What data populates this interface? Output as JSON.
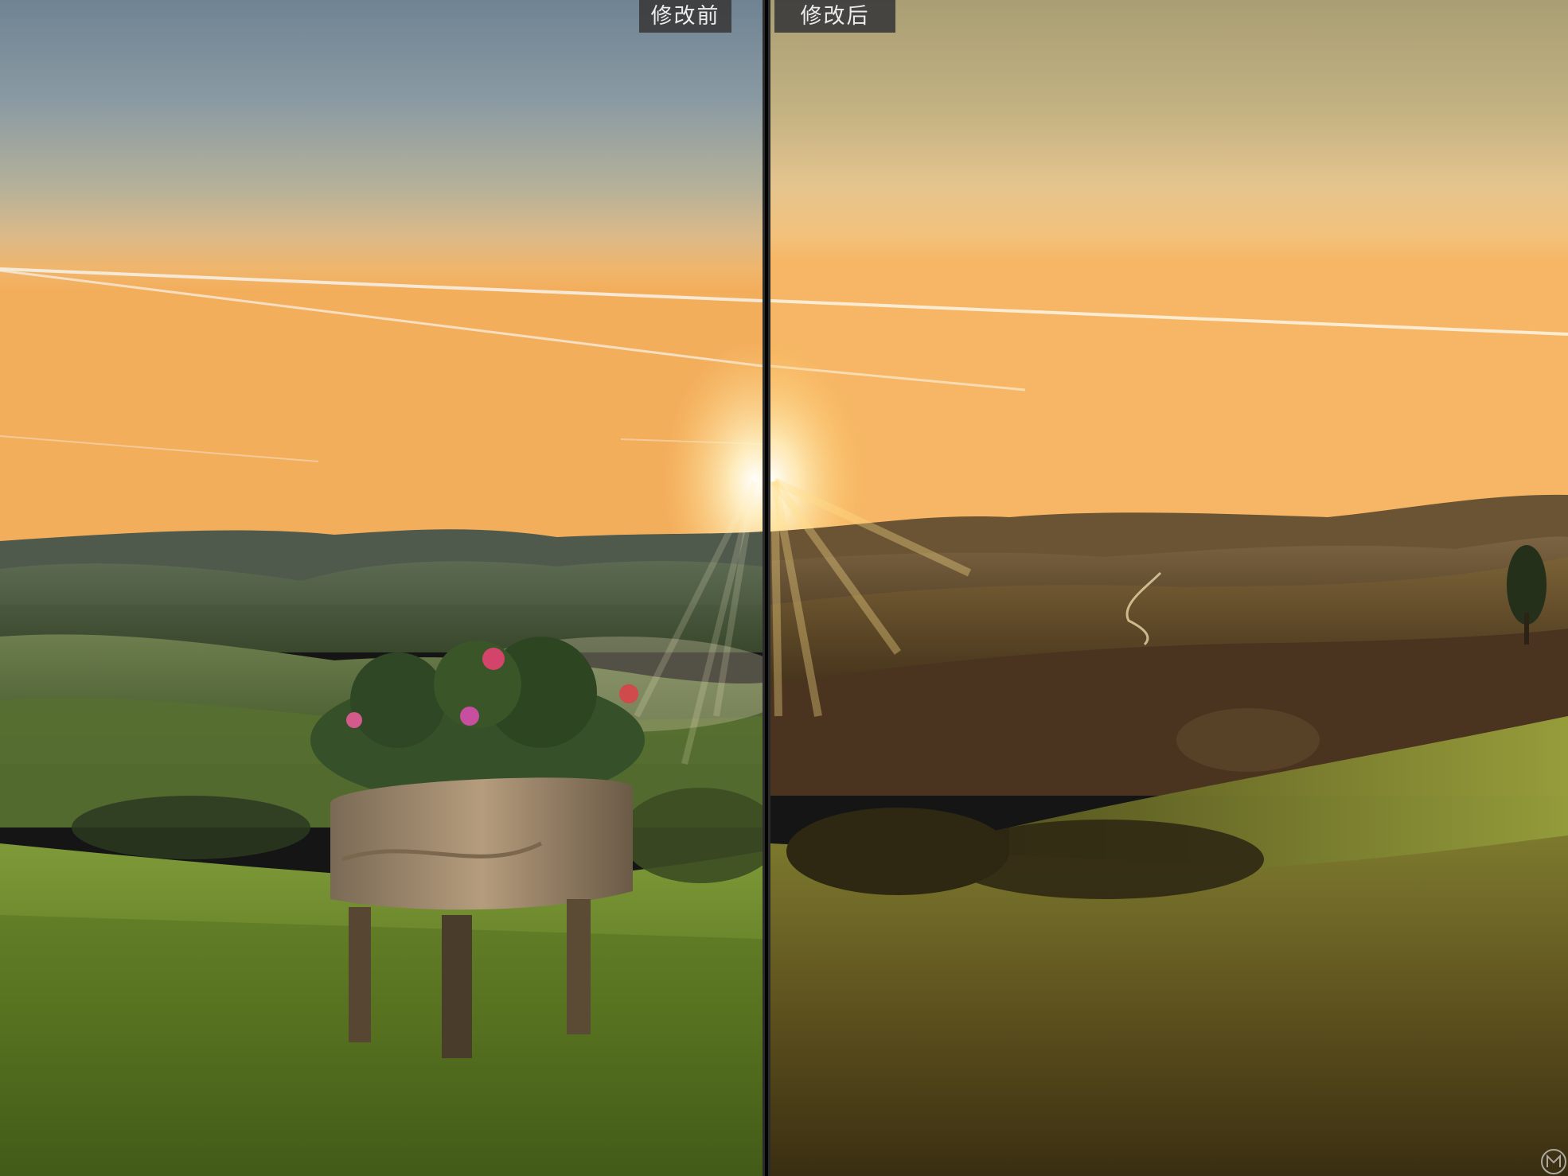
{
  "compare": {
    "before_label": "修改前",
    "after_label": "修改后"
  },
  "icons": {
    "watermark": "watermark-logo-icon"
  },
  "colors": {
    "before_sky_top": "#7d8e9b",
    "before_sky_bottom": "#f0b66c",
    "after_sky_top": "#b7a676",
    "after_sky_bottom": "#f4b868",
    "before_grass": "#6f8a2e",
    "after_grass": "#6d5a22",
    "label_bg": "#3c3c3c",
    "label_text": "#ececec"
  }
}
